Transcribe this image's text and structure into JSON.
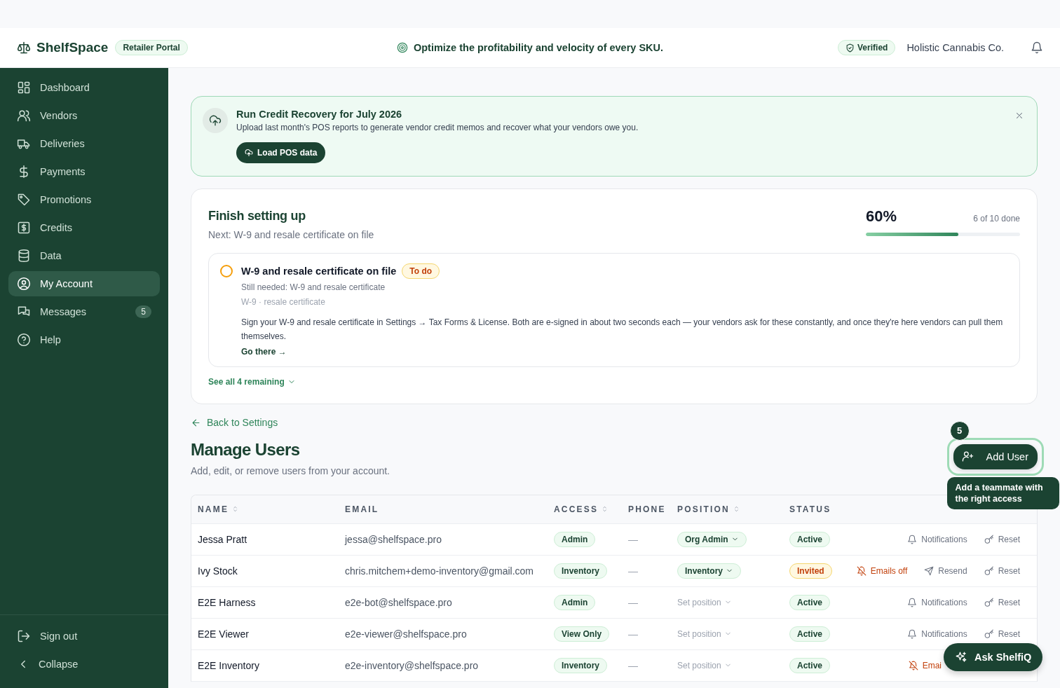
{
  "header": {
    "brand": "ShelfSpace",
    "portal_badge": "Retailer Portal",
    "tagline": "Optimize the profitability and velocity of every SKU.",
    "verified_badge": "Verified",
    "account_name": "Holistic Cannabis Co."
  },
  "sidebar": {
    "items": [
      {
        "label": "Dashboard",
        "selected": false
      },
      {
        "label": "Vendors",
        "selected": false
      },
      {
        "label": "Deliveries",
        "selected": false
      },
      {
        "label": "Payments",
        "selected": false
      },
      {
        "label": "Promotions",
        "selected": false
      },
      {
        "label": "Credits",
        "selected": false
      },
      {
        "label": "Data",
        "selected": false
      },
      {
        "label": "My Account",
        "selected": true
      },
      {
        "label": "Messages",
        "selected": false,
        "badge": "5"
      },
      {
        "label": "Help",
        "selected": false
      }
    ],
    "footer": [
      {
        "label": "Sign out",
        "kind": "signout"
      },
      {
        "label": "Collapse",
        "kind": "collapse"
      }
    ]
  },
  "banner": {
    "title": "Run Credit Recovery for July 2026",
    "text": "Upload last month's POS reports to generate vendor credit memos and recover what your vendors owe you.",
    "button": "Load POS data"
  },
  "setup": {
    "title": "Finish setting up",
    "subtitle": "Next: W-9 and resale certificate on file",
    "percent": "60%",
    "count": "6 of 10 done",
    "level": 0.6,
    "step": {
      "title": "W-9 and resale certificate on file",
      "done": false,
      "tag": "To do",
      "needed": "Still needed: W-9 and resale certificate",
      "items": "W-9 · resale certificate",
      "description": "Sign your W-9 and resale certificate in Settings → Tax Forms & License. Both are e-signed in about two seconds each — your vendors ask for these constantly, and once they're here vendors can pull them themselves.",
      "link": "Go there →"
    },
    "see_all": "See all 4 remaining"
  },
  "users": {
    "back_link": "Back to Settings",
    "title": "Manage Users",
    "subtitle": "Add, edit, or remove users from your account.",
    "add_button": "Add User",
    "coach_step": "5",
    "coach_tip": "Add a teammate with the right access",
    "columns": [
      {
        "label": "NAME",
        "sortable": true
      },
      {
        "label": "EMAIL",
        "sortable": false
      },
      {
        "label": "ACCESS",
        "sortable": true
      },
      {
        "label": "PHONE",
        "sortable": false
      },
      {
        "label": "POSITION",
        "sortable": true
      },
      {
        "label": "STATUS",
        "sortable": false
      }
    ],
    "rows": [
      {
        "name": "Jessa Pratt",
        "email": "jessa@shelfspace.pro",
        "access": "Admin",
        "phone": "—",
        "position": {
          "text": "Org Admin",
          "kind": "set"
        },
        "status": {
          "text": "Active",
          "kind": "active"
        },
        "actions": [
          {
            "label": "Notifications",
            "kind": "notifications"
          },
          {
            "label": "Reset",
            "kind": "reset"
          }
        ]
      },
      {
        "name": "Ivy Stock",
        "email": "chris.mitchem+demo-inventory@gmail.com",
        "access": "Inventory",
        "phone": "—",
        "position": {
          "text": "Inventory",
          "kind": "set"
        },
        "status": {
          "text": "Invited",
          "kind": "invited"
        },
        "actions": [
          {
            "label": "Emails off",
            "kind": "emails_off"
          },
          {
            "label": "Resend",
            "kind": "resend"
          },
          {
            "label": "Reset",
            "kind": "reset"
          }
        ]
      },
      {
        "name": "E2E Harness",
        "email": "e2e-bot@shelfspace.pro",
        "access": "Admin",
        "phone": "—",
        "position": {
          "text": "Set position",
          "kind": "unset"
        },
        "status": {
          "text": "Active",
          "kind": "active"
        },
        "actions": [
          {
            "label": "Notifications",
            "kind": "notifications"
          },
          {
            "label": "Reset",
            "kind": "reset"
          }
        ]
      },
      {
        "name": "E2E Viewer",
        "email": "e2e-viewer@shelfspace.pro",
        "access": "View Only",
        "phone": "—",
        "position": {
          "text": "Set position",
          "kind": "unset"
        },
        "status": {
          "text": "Active",
          "kind": "active"
        },
        "actions": [
          {
            "label": "Notifications",
            "kind": "notifications"
          },
          {
            "label": "Reset",
            "kind": "reset"
          }
        ]
      },
      {
        "name": "E2E Inventory",
        "email": "e2e-inventory@shelfspace.pro",
        "access": "Inventory",
        "phone": "—",
        "position": {
          "text": "Set position",
          "kind": "unset"
        },
        "status": {
          "text": "Active",
          "kind": "active"
        },
        "actions": [
          {
            "label": "Emai",
            "kind": "emails_off"
          }
        ]
      }
    ]
  },
  "assistant": {
    "label": "Ask ShelfiQ"
  }
}
